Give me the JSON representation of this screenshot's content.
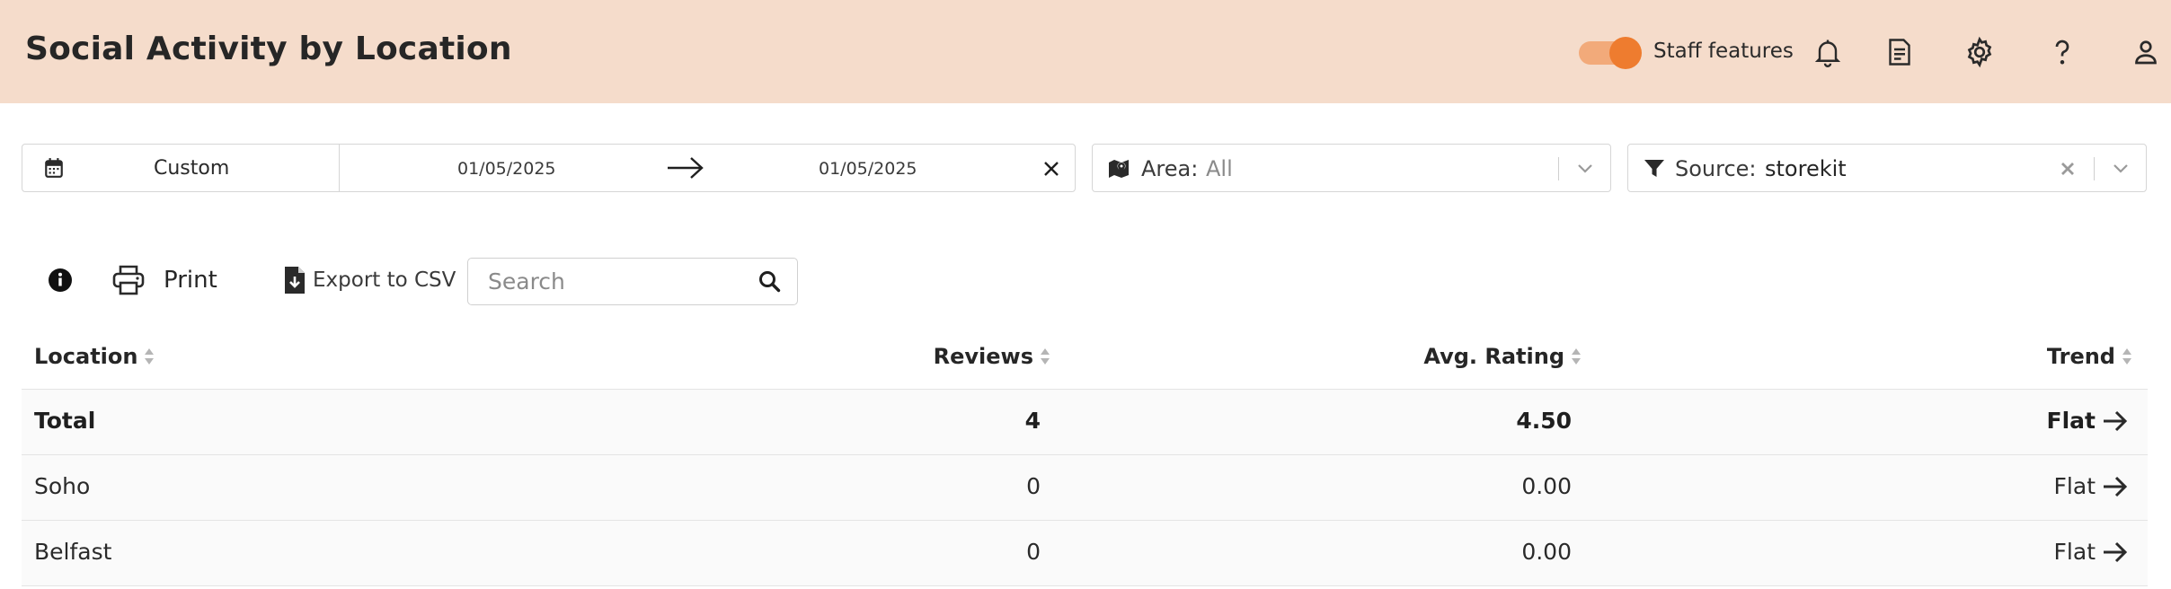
{
  "header": {
    "title": "Social Activity by Location",
    "staff_toggle_label": "Staff features",
    "staff_toggle_on": true,
    "icons": [
      "bell-icon",
      "report-icon",
      "gear-icon",
      "help-icon",
      "user-icon"
    ]
  },
  "filters": {
    "date_preset": "Custom",
    "date_start": "01/05/2025",
    "date_end": "01/05/2025",
    "area_label": "Area:",
    "area_value": "All",
    "source_label": "Source:",
    "source_value": "storekit"
  },
  "toolbar": {
    "print_label": "Print",
    "export_label": "Export to CSV",
    "search_placeholder": "Search"
  },
  "table": {
    "columns": [
      "Location",
      "Reviews",
      "Avg. Rating",
      "Trend"
    ],
    "rows": [
      {
        "location": "Total",
        "reviews": "4",
        "rating": "4.50",
        "trend": "Flat"
      },
      {
        "location": "Soho",
        "reviews": "0",
        "rating": "0.00",
        "trend": "Flat"
      },
      {
        "location": "Belfast",
        "reviews": "0",
        "rating": "0.00",
        "trend": "Flat"
      }
    ]
  },
  "colors": {
    "header_bg": "#f5dccb",
    "accent": "#ee7c2f"
  }
}
